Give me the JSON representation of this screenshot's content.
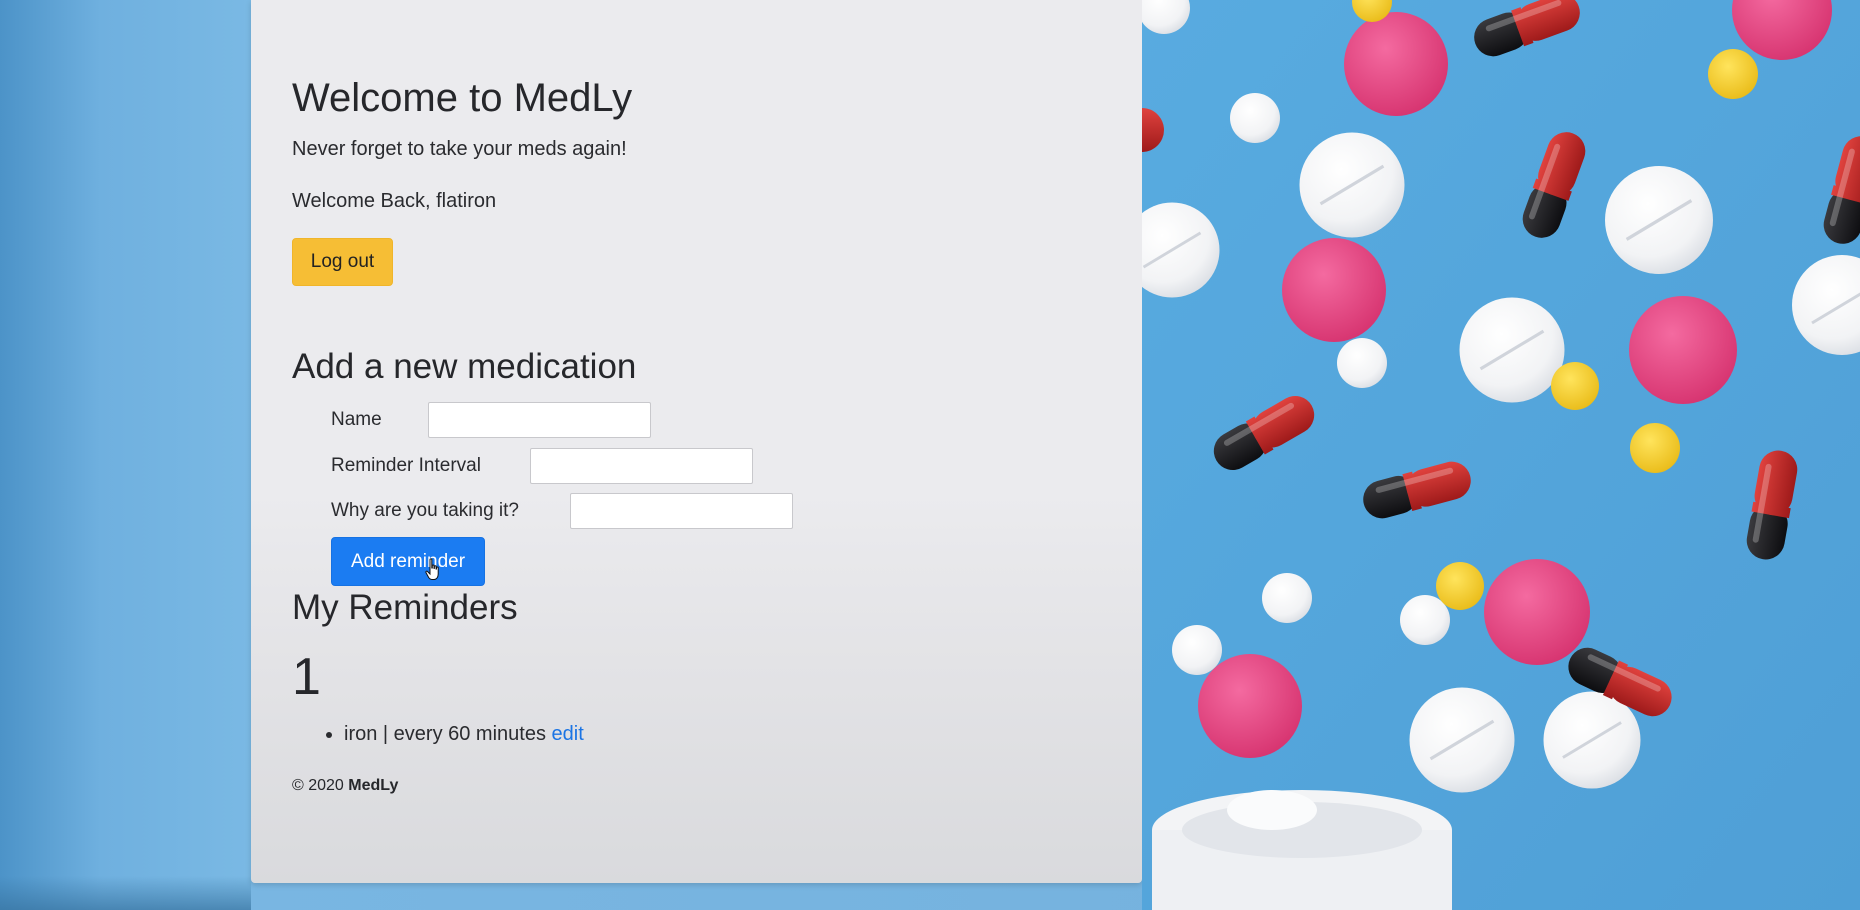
{
  "app": {
    "title": "Welcome to MedLy",
    "tagline": "Never forget to take your meds again!",
    "welcome": "Welcome Back, flatiron",
    "logout_label": "Log out"
  },
  "form": {
    "title": "Add a new medication",
    "name_label": "Name",
    "name_value": "",
    "interval_label": "Reminder Interval",
    "interval_value": "",
    "why_label": "Why are you taking it?",
    "why_value": "",
    "submit_label": "Add reminder"
  },
  "reminders": {
    "title": "My Reminders",
    "count": "1",
    "items": [
      {
        "text": "iron | every 60 minutes ",
        "edit_label": "edit"
      }
    ]
  },
  "footer": {
    "copyright": "© 2020 ",
    "brand": "MedLy"
  },
  "colors": {
    "logout_button": "#f6be35",
    "add_button": "#1b7cf2",
    "link": "#1b74e4",
    "card_bg": "#ebebee",
    "image_bg": "#5fb0e0"
  }
}
